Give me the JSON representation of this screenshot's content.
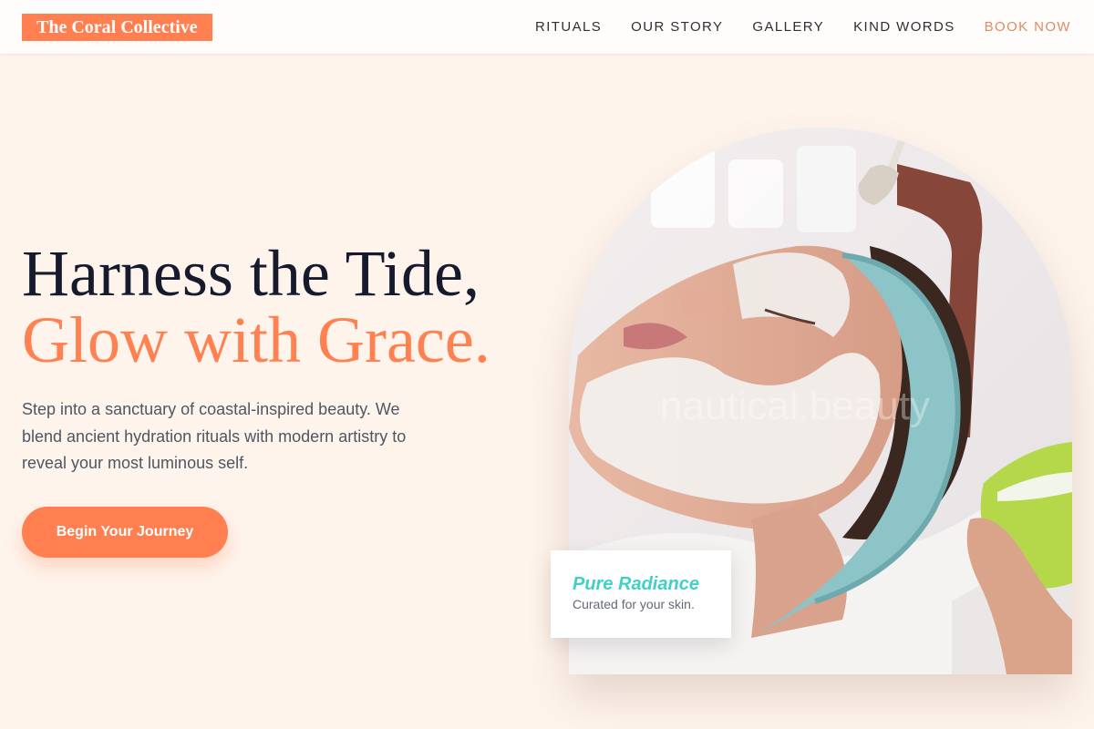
{
  "brand": {
    "name": "The Coral Collective"
  },
  "nav": {
    "links": [
      "RITUALS",
      "OUR STORY",
      "GALLERY",
      "KIND WORDS"
    ],
    "book": "BOOK NOW"
  },
  "hero": {
    "title_line1": "Harness the Tide,",
    "title_line2": "Glow with Grace.",
    "description": "Step into a sanctuary of coastal-inspired beauty. We blend ancient hydration rituals with modern artistry to reveal your most luminous self.",
    "cta": "Begin Your Journey",
    "image_alt": "Woman receiving a facial mask treatment",
    "watermark": "nautical.beauty"
  },
  "badge": {
    "title": "Pure Radiance",
    "subtitle": "Curated for your skin."
  },
  "colors": {
    "accent": "#ff7f50",
    "teal": "#40d0c8",
    "background": "#fef4ec",
    "heading": "#151a2d"
  }
}
